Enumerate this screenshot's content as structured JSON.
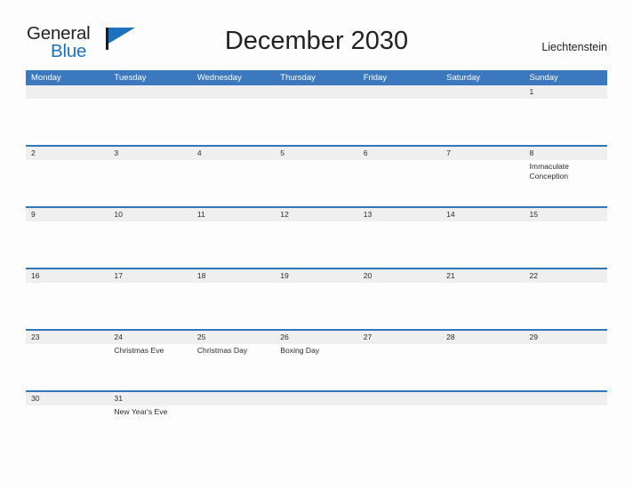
{
  "brand": {
    "name_part1": "General",
    "name_part2": "Blue",
    "flag_icon": "flag-icon",
    "accent_color": "#1c72bd"
  },
  "header": {
    "title": "December 2030",
    "region": "Liechtenstein"
  },
  "theme": {
    "header_blue": "#3b78bd",
    "row_divider_blue": "#2f77b8",
    "number_band_gray": "#efefef",
    "page_background": "#fdfdfd",
    "text_color": "#2b2b2b"
  },
  "calendar": {
    "month": "December",
    "year": "2030",
    "weekday_headers": [
      "Monday",
      "Tuesday",
      "Wednesday",
      "Thursday",
      "Friday",
      "Saturday",
      "Sunday"
    ],
    "weeks": [
      {
        "days": [
          {
            "number": "",
            "event": ""
          },
          {
            "number": "",
            "event": ""
          },
          {
            "number": "",
            "event": ""
          },
          {
            "number": "",
            "event": ""
          },
          {
            "number": "",
            "event": ""
          },
          {
            "number": "",
            "event": ""
          },
          {
            "number": "1",
            "event": ""
          }
        ]
      },
      {
        "days": [
          {
            "number": "2",
            "event": ""
          },
          {
            "number": "3",
            "event": ""
          },
          {
            "number": "4",
            "event": ""
          },
          {
            "number": "5",
            "event": ""
          },
          {
            "number": "6",
            "event": ""
          },
          {
            "number": "7",
            "event": ""
          },
          {
            "number": "8",
            "event": "Immaculate Conception"
          }
        ]
      },
      {
        "days": [
          {
            "number": "9",
            "event": ""
          },
          {
            "number": "10",
            "event": ""
          },
          {
            "number": "11",
            "event": ""
          },
          {
            "number": "12",
            "event": ""
          },
          {
            "number": "13",
            "event": ""
          },
          {
            "number": "14",
            "event": ""
          },
          {
            "number": "15",
            "event": ""
          }
        ]
      },
      {
        "days": [
          {
            "number": "16",
            "event": ""
          },
          {
            "number": "17",
            "event": ""
          },
          {
            "number": "18",
            "event": ""
          },
          {
            "number": "19",
            "event": ""
          },
          {
            "number": "20",
            "event": ""
          },
          {
            "number": "21",
            "event": ""
          },
          {
            "number": "22",
            "event": ""
          }
        ]
      },
      {
        "days": [
          {
            "number": "23",
            "event": ""
          },
          {
            "number": "24",
            "event": "Christmas Eve"
          },
          {
            "number": "25",
            "event": "Christmas Day"
          },
          {
            "number": "26",
            "event": "Boxing Day"
          },
          {
            "number": "27",
            "event": ""
          },
          {
            "number": "28",
            "event": ""
          },
          {
            "number": "29",
            "event": ""
          }
        ]
      },
      {
        "days": [
          {
            "number": "30",
            "event": ""
          },
          {
            "number": "31",
            "event": "New Year's Eve"
          },
          {
            "number": "",
            "event": ""
          },
          {
            "number": "",
            "event": ""
          },
          {
            "number": "",
            "event": ""
          },
          {
            "number": "",
            "event": ""
          },
          {
            "number": "",
            "event": ""
          }
        ]
      }
    ]
  }
}
